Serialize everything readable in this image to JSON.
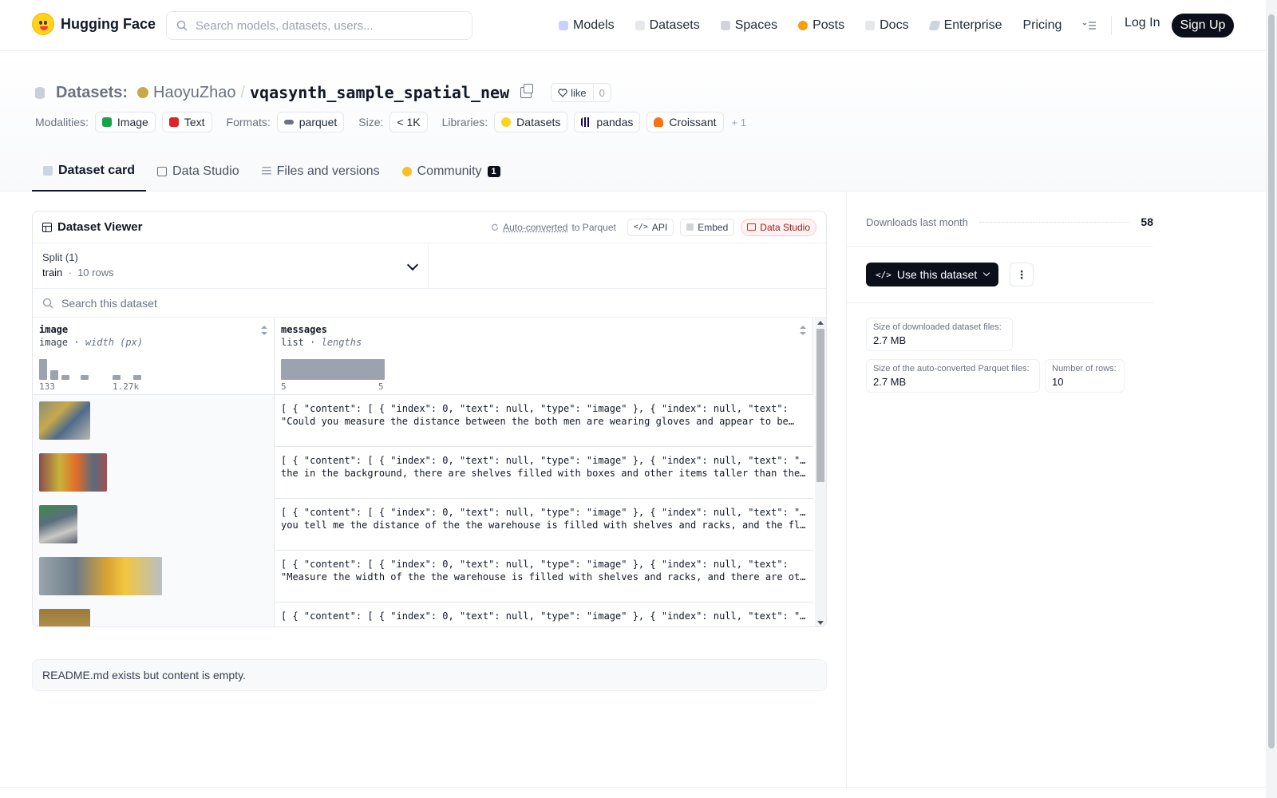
{
  "nav": {
    "brand": "Hugging Face",
    "search_placeholder": "Search models, datasets, users...",
    "links": [
      "Models",
      "Datasets",
      "Spaces",
      "Posts",
      "Docs",
      "Enterprise",
      "Pricing"
    ],
    "login": "Log In",
    "signup": "Sign Up"
  },
  "header": {
    "section": "Datasets:",
    "owner": "HaoyuZhao",
    "separator": "/",
    "repo": "vqasynth_sample_spatial_new",
    "like_label": "like",
    "like_count": "0",
    "modalities_label": "Modalities:",
    "modalities": [
      "Image",
      "Text"
    ],
    "formats_label": "Formats:",
    "format": "parquet",
    "size_label": "Size:",
    "size": "< 1K",
    "libraries_label": "Libraries:",
    "libraries": [
      "Datasets",
      "pandas",
      "Croissant"
    ],
    "more_libraries": "+ 1"
  },
  "tabs": [
    {
      "label": "Dataset card",
      "active": true
    },
    {
      "label": "Data Studio"
    },
    {
      "label": "Files and versions"
    },
    {
      "label": "Community",
      "badge": "1"
    }
  ],
  "viewer": {
    "title": "Dataset Viewer",
    "auto_converted": "Auto-converted",
    "to_parquet": "to Parquet",
    "api": "API",
    "embed": "Embed",
    "data_studio": "Data Studio",
    "split_label": "Split (1)",
    "split_value": "train",
    "split_rows": "10 rows",
    "search_placeholder": "Search this dataset",
    "columns": [
      {
        "name": "image",
        "type": "image",
        "stat": "width (px)",
        "min": "133",
        "max": "1.27k"
      },
      {
        "name": "messages",
        "type": "list",
        "stat": "lengths",
        "min": "5",
        "max": "5"
      }
    ],
    "rows": [
      {
        "line1": "[ { \"content\": [ { \"index\": 0, \"text\": null, \"type\": \"image\" }, { \"index\": null, \"text\":",
        "line2": "\"Could you measure the distance between the both men are wearing gloves and appear to be…"
      },
      {
        "line1": "[ { \"content\": [ { \"index\": 0, \"text\": null, \"type\": \"image\" }, { \"index\": null, \"text\": \"Is",
        "line2": "the in the background, there are shelves filled with boxes and other items taller than the in…"
      },
      {
        "line1": "[ { \"content\": [ { \"index\": 0, \"text\": null, \"type\": \"image\" }, { \"index\": null, \"text\": \"Can",
        "line2": "you tell me the distance of the the warehouse is filled with shelves and racks, and the floor…"
      },
      {
        "line1": "[ { \"content\": [ { \"index\": 0, \"text\": null, \"type\": \"image\" }, { \"index\": null, \"text\":",
        "line2": "\"Measure the width of the the warehouse is filled with shelves and racks, and there are other…"
      },
      {
        "line1": "[ { \"content\": [ { \"index\": 0, \"text\": null, \"type\": \"image\" }, { \"index\": null, \"text\": \"Give",
        "line2": ""
      }
    ]
  },
  "readme": "README.md exists but content is empty.",
  "sidebar": {
    "downloads_label": "Downloads last month",
    "downloads": "58",
    "use_button": "Use this dataset",
    "download_size_label": "Size of downloaded dataset files:",
    "download_size": "2.7 MB",
    "parquet_size_label": "Size of the auto-converted Parquet files:",
    "parquet_size": "2.7 MB",
    "rows_label": "Number of rows:",
    "rows": "10"
  },
  "colors": {
    "accent_dark": "#0b0f19",
    "brand_yellow": "#ffd21e"
  }
}
